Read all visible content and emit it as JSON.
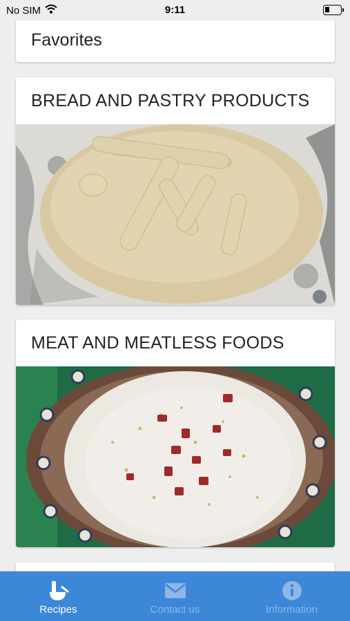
{
  "status_bar": {
    "carrier": "No SIM",
    "time": "9:11"
  },
  "favorites": {
    "title": "Favorites"
  },
  "categories": [
    {
      "title": "BREAD AND PASTRY PRODUCTS",
      "image": "decorated-bread-dough"
    },
    {
      "title": "MEAT AND MEATLESS FOODS",
      "image": "soup-in-painted-bowl"
    },
    {
      "title": "",
      "image": ""
    }
  ],
  "tab_bar": {
    "tabs": [
      {
        "label": "Recipes",
        "icon": "mortar-pestle-icon",
        "active": true
      },
      {
        "label": "Contact us",
        "icon": "envelope-icon",
        "active": false
      },
      {
        "label": "Information",
        "icon": "info-icon",
        "active": false
      }
    ]
  },
  "colors": {
    "tab_bar": "#3c87d8",
    "tab_active": "#ffffff",
    "tab_inactive": "#8eb6e6",
    "background": "#eeeeee"
  }
}
